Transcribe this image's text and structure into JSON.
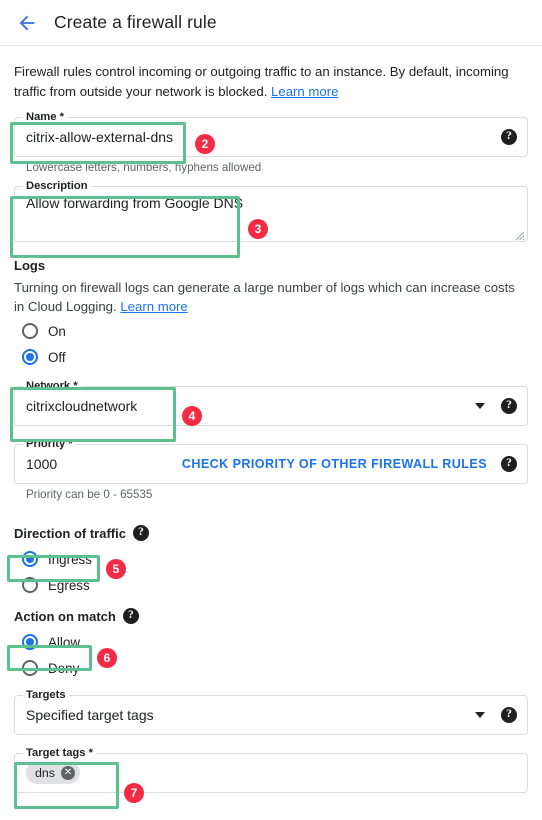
{
  "header": {
    "back_icon": "arrow-left-icon",
    "title": "Create a firewall rule"
  },
  "intro": {
    "text": "Firewall rules control incoming or outgoing traffic to an instance. By default, incoming traffic from outside your network is blocked. ",
    "link_label": "Learn more"
  },
  "name_field": {
    "label": "Name *",
    "value": "citrix-allow-external-dns",
    "help_icon": "help-icon",
    "helper_text": "Lowercase letters, numbers, hyphens allowed"
  },
  "description_field": {
    "label": "Description",
    "value": "Allow forwarding from Google DNS",
    "resize_handle": "resize-grip-icon"
  },
  "logs": {
    "heading": "Logs",
    "description": "Turning on firewall logs can generate a large number of logs which can increase costs in Cloud Logging. ",
    "link_label": "Learn more",
    "options": [
      {
        "label": "On",
        "selected": false
      },
      {
        "label": "Off",
        "selected": true
      }
    ]
  },
  "network_field": {
    "label": "Network *",
    "value": "citrixcloudnetwork",
    "dropdown_icon": "chevron-down-icon",
    "help_icon": "help-icon"
  },
  "priority_field": {
    "label": "Priority *",
    "value": "1000",
    "action_label": "CHECK PRIORITY OF OTHER FIREWALL RULES",
    "help_icon": "help-icon",
    "helper_text": "Priority can be 0 - 65535"
  },
  "direction": {
    "heading": "Direction of traffic",
    "help_icon": "help-icon",
    "options": [
      {
        "label": "Ingress",
        "selected": true
      },
      {
        "label": "Egress",
        "selected": false
      }
    ]
  },
  "action_on_match": {
    "heading": "Action on match",
    "help_icon": "help-icon",
    "options": [
      {
        "label": "Allow",
        "selected": true
      },
      {
        "label": "Deny",
        "selected": false
      }
    ]
  },
  "targets_field": {
    "label": "Targets",
    "value": "Specified target tags",
    "dropdown_icon": "chevron-down-icon",
    "help_icon": "help-icon"
  },
  "target_tags_field": {
    "label": "Target tags *",
    "chips": [
      {
        "label": "dns",
        "remove_icon": "chip-remove-icon"
      }
    ]
  },
  "annotations": {
    "highlight_color": "#5cc090",
    "badge_color": "#f42b45",
    "badges": [
      {
        "number": "2",
        "target": "name-field"
      },
      {
        "number": "3",
        "target": "description-field"
      },
      {
        "number": "4",
        "target": "network-field"
      },
      {
        "number": "5",
        "target": "ingress-radio"
      },
      {
        "number": "6",
        "target": "allow-radio"
      },
      {
        "number": "7",
        "target": "target-tags-field"
      }
    ]
  }
}
